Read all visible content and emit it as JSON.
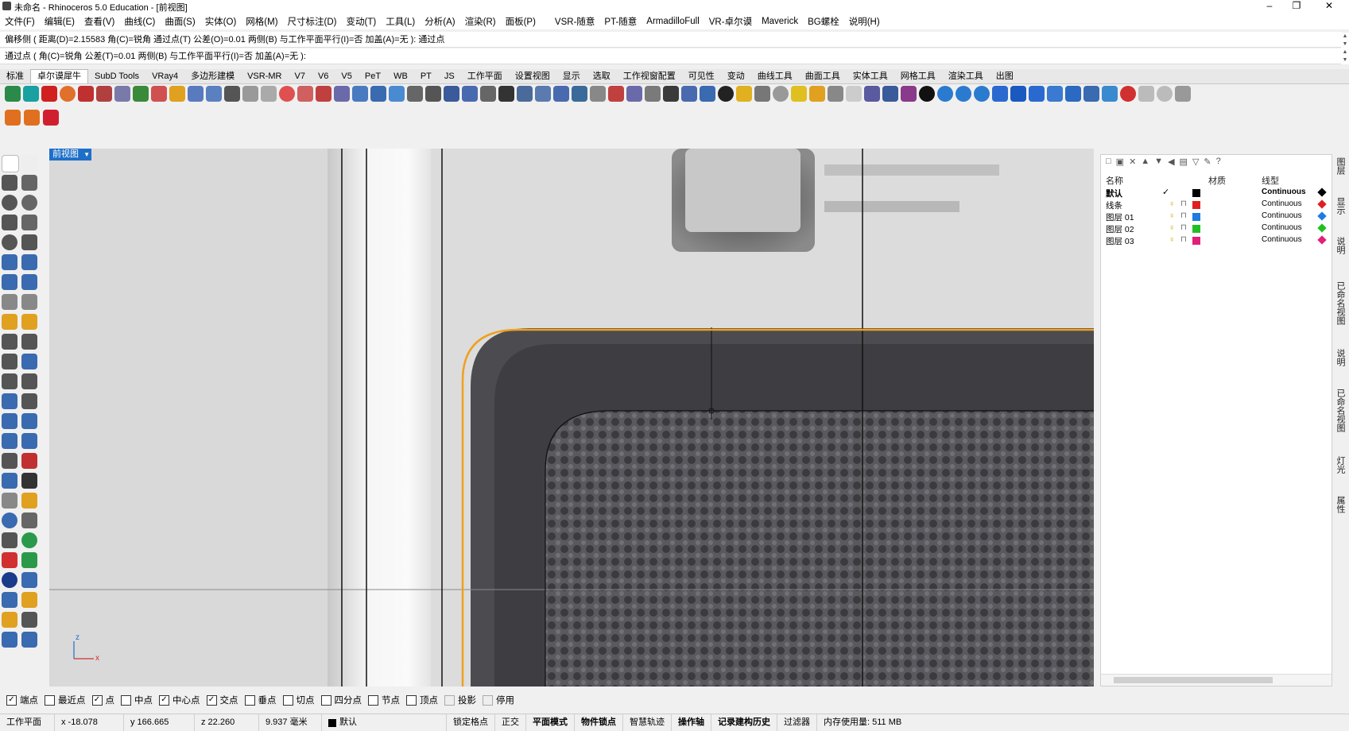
{
  "window": {
    "title": "未命名 - Rhinoceros 5.0 Education - [前视图]",
    "minimize": "–",
    "maximize": "❐",
    "close": "✕"
  },
  "menu": [
    "文件(F)",
    "编辑(E)",
    "查看(V)",
    "曲线(C)",
    "曲面(S)",
    "实体(O)",
    "网格(M)",
    "尺寸标注(D)",
    "变动(T)",
    "工具(L)",
    "分析(A)",
    "渲染(R)",
    "面板(P)",
    "VSR-随意",
    "PT-随意",
    "ArmadilloFull",
    "VR-卓尔谟",
    "Maverick",
    "BG螺栓",
    "说明(H)"
  ],
  "command": {
    "history": "偏移侧 ( 距离(D)=2.15583  角(C)=锐角  通过点(T)  公差(O)=0.01  两侧(B)  与工作平面平行(I)=否  加盖(A)=无 ): 通过点",
    "prompt": "通过点 ( 角(C)=锐角  公差(T)=0.01  两侧(B)  与工作平面平行(I)=否  加盖(A)=无 ):"
  },
  "tabs": [
    "标准",
    "卓尔谟犀牛",
    "SubD Tools",
    "VRay4",
    "多边形建模",
    "VSR-MR",
    "V7",
    "V6",
    "V5",
    "PeT",
    "WB",
    "PT",
    "JS",
    "工作平面",
    "设置视图",
    "显示",
    "选取",
    "工作视窗配置",
    "可见性",
    "变动",
    "曲线工具",
    "曲面工具",
    "实体工具",
    "网格工具",
    "渲染工具",
    "出图"
  ],
  "active_tab": "卓尔谟犀牛",
  "viewport": {
    "label": "前视图",
    "axis_z": "z",
    "axis_x": "x"
  },
  "layers_panel": {
    "columns": {
      "name": "名称",
      "material": "材质",
      "linetype": "线型"
    },
    "rows": [
      {
        "name": "默认",
        "current": "✓",
        "color": "#000000",
        "linetype": "Continuous",
        "bold": true
      },
      {
        "name": "线条",
        "current": "",
        "color": "#e02020",
        "linetype": "Continuous",
        "bold": false
      },
      {
        "name": "图层 01",
        "current": "",
        "color": "#1e7be0",
        "linetype": "Continuous",
        "bold": false
      },
      {
        "name": "图层 02",
        "current": "",
        "color": "#20c020",
        "linetype": "Continuous",
        "bold": false
      },
      {
        "name": "图层 03",
        "current": "",
        "color": "#e0207a",
        "linetype": "Continuous",
        "bold": false
      }
    ]
  },
  "side_tabs": [
    "图层",
    "显示",
    "说明",
    "已命名视图",
    "说明",
    "已命名视图",
    "灯光",
    "属性"
  ],
  "osnap": [
    {
      "label": "端点",
      "checked": true
    },
    {
      "label": "最近点",
      "checked": false
    },
    {
      "label": "点",
      "checked": true
    },
    {
      "label": "中点",
      "checked": false
    },
    {
      "label": "中心点",
      "checked": true
    },
    {
      "label": "交点",
      "checked": true
    },
    {
      "label": "垂点",
      "checked": false
    },
    {
      "label": "切点",
      "checked": false
    },
    {
      "label": "四分点",
      "checked": false
    },
    {
      "label": "节点",
      "checked": false
    },
    {
      "label": "顶点",
      "checked": false
    },
    {
      "label": "投影",
      "checked": false,
      "disabled": true
    },
    {
      "label": "停用",
      "checked": false,
      "disabled": true
    }
  ],
  "status": {
    "cplane": "工作平面",
    "x": "x -18.078",
    "y": "y 166.665",
    "z": "z 22.260",
    "distance": "9.937 毫米",
    "layer": "默认",
    "grid_snap": "锁定格点",
    "ortho": "正交",
    "planar": "平面模式",
    "osnap": "物件锁点",
    "smarttrack": "智慧轨迹",
    "gumball": "操作轴",
    "history": "记录建构历史",
    "filter": "过滤器",
    "memory": "内存使用量: 511 MB"
  },
  "colors": {
    "accent_blue": "#1e6fc9",
    "selection_orange": "#f0a020"
  }
}
